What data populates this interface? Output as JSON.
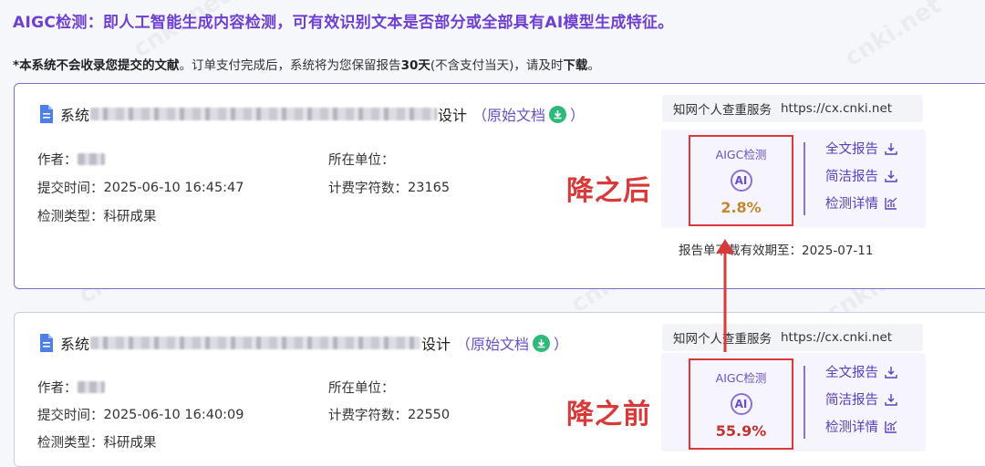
{
  "headline": "AIGC检测：即人工智能生成内容检测，可有效识别文本是否部分或全部具有AI模型生成特征。",
  "notice": {
    "star": "*",
    "bold1": "本系统不会收录您提交的文献",
    "mid": "。订单支付完成后，系统将为您保留报告",
    "bold2": "30天",
    "tail": "(不含支付当天)，请及时",
    "bold3": "下载",
    "end": "。"
  },
  "cards": [
    {
      "title_prefix": "系统",
      "title_suffix": "设计",
      "original_doc": "（原始文档",
      "original_doc_close": "）",
      "service_name": "知网个人查重服务",
      "service_url": "https://cx.cnki.net",
      "author_label": "作者：",
      "unit_label": "所在单位：",
      "submit_label": "提交时间：",
      "submit_time": "2025-06-10 16:45:47",
      "chars_label": "计费字符数：",
      "chars": "23165",
      "type_label": "检测类型：",
      "type": "科研成果",
      "aigc_label": "AIGC检测",
      "ai_icon_text": "AI",
      "aigc_percent": "2.8%",
      "link_full": "全文报告",
      "link_brief": "简洁报告",
      "link_detail": "检测详情",
      "expiry": "报告单下载有效期至：2025-07-11",
      "annotation": "降之后"
    },
    {
      "title_prefix": "系统",
      "title_suffix": "设计",
      "original_doc": "（原始文档",
      "original_doc_close": "）",
      "service_name": "知网个人查重服务",
      "service_url": "https://cx.cnki.net",
      "author_label": "作者：",
      "unit_label": "所在单位：",
      "submit_label": "提交时间：",
      "submit_time": "2025-06-10 16:40:09",
      "chars_label": "计费字符数：",
      "chars": "22550",
      "type_label": "检测类型：",
      "type": "科研成果",
      "aigc_label": "AIGC检测",
      "ai_icon_text": "AI",
      "aigc_percent": "55.9%",
      "link_full": "全文报告",
      "link_brief": "简洁报告",
      "link_detail": "检测详情",
      "annotation": "降之前"
    }
  ],
  "watermark_text": "cnki.net",
  "colors": {
    "accent": "#6f3fd1",
    "highlight": "#d83a3a",
    "download": "#2eb87a"
  },
  "icons": [
    "document-icon",
    "download-icon",
    "ai-icon",
    "report-download-icon",
    "chart-icon",
    "arrow-up-icon"
  ]
}
